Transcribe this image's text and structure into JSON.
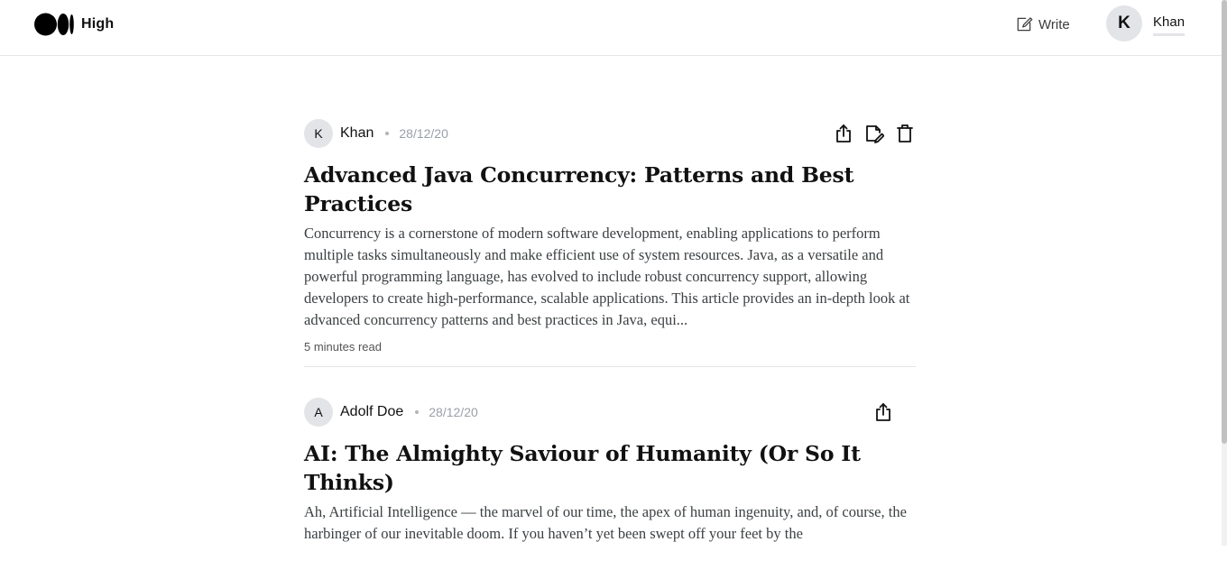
{
  "header": {
    "brand_name": "High",
    "write_label": "Write",
    "user_initial": "K",
    "user_name": "Khan"
  },
  "articles": [
    {
      "author_initial": "K",
      "author": "Khan",
      "date": "28/12/20",
      "title": "Advanced Java Concurrency: Patterns and Best Practices",
      "excerpt": "Concurrency is a cornerstone of modern software development, enabling applications to perform multiple tasks simultaneously and make efficient use of system resources. Java, as a versatile and powerful programming language, has evolved to include robust concurrency support, allowing developers to create high-performance, scalable applications. This article provides an in-depth look at advanced concurrency patterns and best practices in Java, equi...",
      "read_time": "5 minutes read",
      "actions": [
        "share-icon",
        "edit-icon",
        "delete-icon"
      ]
    },
    {
      "author_initial": "A",
      "author": "Adolf Doe",
      "date": "28/12/20",
      "title": "AI: The Almighty Saviour of Humanity (Or So It Thinks)",
      "excerpt": "Ah, Artificial Intelligence — the marvel of our time, the apex of human ingenuity, and, of course, the harbinger of our inevitable doom. If you haven’t yet been swept off your feet by the",
      "actions": [
        "share-icon"
      ]
    }
  ]
}
